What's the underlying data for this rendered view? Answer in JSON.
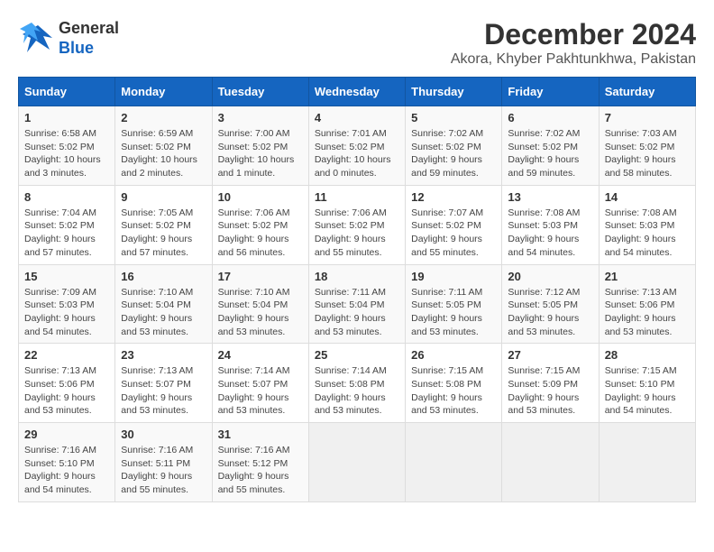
{
  "header": {
    "logo_line1": "General",
    "logo_line2": "Blue",
    "title": "December 2024",
    "subtitle": "Akora, Khyber Pakhtunkhwa, Pakistan"
  },
  "calendar": {
    "days_of_week": [
      "Sunday",
      "Monday",
      "Tuesday",
      "Wednesday",
      "Thursday",
      "Friday",
      "Saturday"
    ],
    "weeks": [
      [
        {
          "day": "",
          "empty": true
        },
        {
          "day": "",
          "empty": true
        },
        {
          "day": "",
          "empty": true
        },
        {
          "day": "",
          "empty": true
        },
        {
          "day": "",
          "empty": true
        },
        {
          "day": "",
          "empty": true
        },
        {
          "day": "",
          "empty": true
        }
      ],
      [
        {
          "day": "1",
          "sunrise": "6:58 AM",
          "sunset": "5:02 PM",
          "daylight": "10 hours and 3 minutes."
        },
        {
          "day": "2",
          "sunrise": "6:59 AM",
          "sunset": "5:02 PM",
          "daylight": "10 hours and 2 minutes."
        },
        {
          "day": "3",
          "sunrise": "7:00 AM",
          "sunset": "5:02 PM",
          "daylight": "10 hours and 1 minute."
        },
        {
          "day": "4",
          "sunrise": "7:01 AM",
          "sunset": "5:02 PM",
          "daylight": "10 hours and 0 minutes."
        },
        {
          "day": "5",
          "sunrise": "7:02 AM",
          "sunset": "5:02 PM",
          "daylight": "9 hours and 59 minutes."
        },
        {
          "day": "6",
          "sunrise": "7:02 AM",
          "sunset": "5:02 PM",
          "daylight": "9 hours and 59 minutes."
        },
        {
          "day": "7",
          "sunrise": "7:03 AM",
          "sunset": "5:02 PM",
          "daylight": "9 hours and 58 minutes."
        }
      ],
      [
        {
          "day": "8",
          "sunrise": "7:04 AM",
          "sunset": "5:02 PM",
          "daylight": "9 hours and 57 minutes."
        },
        {
          "day": "9",
          "sunrise": "7:05 AM",
          "sunset": "5:02 PM",
          "daylight": "9 hours and 57 minutes."
        },
        {
          "day": "10",
          "sunrise": "7:06 AM",
          "sunset": "5:02 PM",
          "daylight": "9 hours and 56 minutes."
        },
        {
          "day": "11",
          "sunrise": "7:06 AM",
          "sunset": "5:02 PM",
          "daylight": "9 hours and 55 minutes."
        },
        {
          "day": "12",
          "sunrise": "7:07 AM",
          "sunset": "5:02 PM",
          "daylight": "9 hours and 55 minutes."
        },
        {
          "day": "13",
          "sunrise": "7:08 AM",
          "sunset": "5:03 PM",
          "daylight": "9 hours and 54 minutes."
        },
        {
          "day": "14",
          "sunrise": "7:08 AM",
          "sunset": "5:03 PM",
          "daylight": "9 hours and 54 minutes."
        }
      ],
      [
        {
          "day": "15",
          "sunrise": "7:09 AM",
          "sunset": "5:03 PM",
          "daylight": "9 hours and 54 minutes."
        },
        {
          "day": "16",
          "sunrise": "7:10 AM",
          "sunset": "5:04 PM",
          "daylight": "9 hours and 53 minutes."
        },
        {
          "day": "17",
          "sunrise": "7:10 AM",
          "sunset": "5:04 PM",
          "daylight": "9 hours and 53 minutes."
        },
        {
          "day": "18",
          "sunrise": "7:11 AM",
          "sunset": "5:04 PM",
          "daylight": "9 hours and 53 minutes."
        },
        {
          "day": "19",
          "sunrise": "7:11 AM",
          "sunset": "5:05 PM",
          "daylight": "9 hours and 53 minutes."
        },
        {
          "day": "20",
          "sunrise": "7:12 AM",
          "sunset": "5:05 PM",
          "daylight": "9 hours and 53 minutes."
        },
        {
          "day": "21",
          "sunrise": "7:13 AM",
          "sunset": "5:06 PM",
          "daylight": "9 hours and 53 minutes."
        }
      ],
      [
        {
          "day": "22",
          "sunrise": "7:13 AM",
          "sunset": "5:06 PM",
          "daylight": "9 hours and 53 minutes."
        },
        {
          "day": "23",
          "sunrise": "7:13 AM",
          "sunset": "5:07 PM",
          "daylight": "9 hours and 53 minutes."
        },
        {
          "day": "24",
          "sunrise": "7:14 AM",
          "sunset": "5:07 PM",
          "daylight": "9 hours and 53 minutes."
        },
        {
          "day": "25",
          "sunrise": "7:14 AM",
          "sunset": "5:08 PM",
          "daylight": "9 hours and 53 minutes."
        },
        {
          "day": "26",
          "sunrise": "7:15 AM",
          "sunset": "5:08 PM",
          "daylight": "9 hours and 53 minutes."
        },
        {
          "day": "27",
          "sunrise": "7:15 AM",
          "sunset": "5:09 PM",
          "daylight": "9 hours and 53 minutes."
        },
        {
          "day": "28",
          "sunrise": "7:15 AM",
          "sunset": "5:10 PM",
          "daylight": "9 hours and 54 minutes."
        }
      ],
      [
        {
          "day": "29",
          "sunrise": "7:16 AM",
          "sunset": "5:10 PM",
          "daylight": "9 hours and 54 minutes."
        },
        {
          "day": "30",
          "sunrise": "7:16 AM",
          "sunset": "5:11 PM",
          "daylight": "9 hours and 55 minutes."
        },
        {
          "day": "31",
          "sunrise": "7:16 AM",
          "sunset": "5:12 PM",
          "daylight": "9 hours and 55 minutes."
        },
        {
          "day": "",
          "empty": true
        },
        {
          "day": "",
          "empty": true
        },
        {
          "day": "",
          "empty": true
        },
        {
          "day": "",
          "empty": true
        }
      ]
    ]
  }
}
